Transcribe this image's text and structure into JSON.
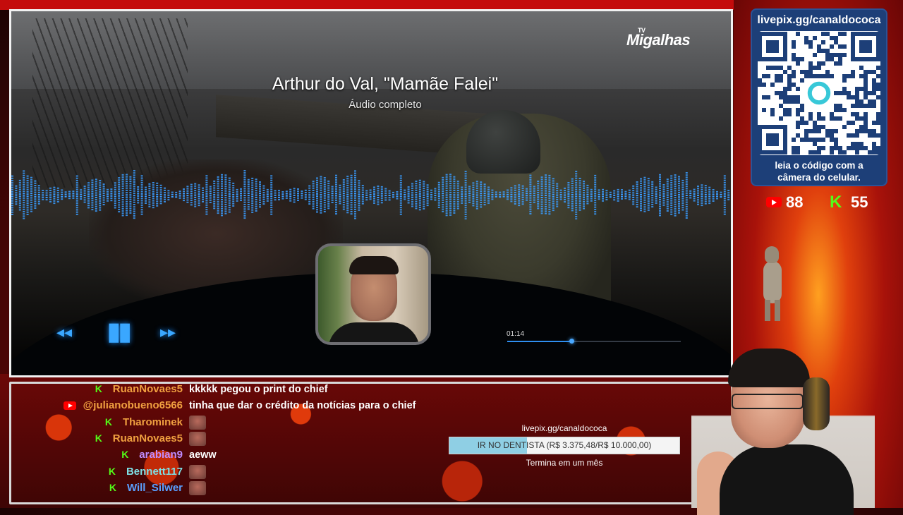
{
  "player": {
    "channel_logo": "Migalhas",
    "channel_logo_small": "TV",
    "title": "Arthur do Val, \"Mamãe Falei\"",
    "subtitle": "Áudio completo",
    "time": "01:14",
    "progress_fraction": 0.37,
    "accent": "#2f8ff0"
  },
  "chat": [
    {
      "platform": "kick",
      "user": "RuanNovaes5",
      "user_color": "#f0a040",
      "message": "kkkkk pegou o print do chief",
      "emote": false
    },
    {
      "platform": "youtube",
      "user": "@julianobueno6566",
      "user_color": "#f0a040",
      "message": "tinha que dar o crédito da notícias para o chief",
      "emote": false
    },
    {
      "platform": "kick",
      "user": "Tharominek",
      "user_color": "#f0a040",
      "message": "",
      "emote": true
    },
    {
      "platform": "kick",
      "user": "RuanNovaes5",
      "user_color": "#f0a040",
      "message": "",
      "emote": true
    },
    {
      "platform": "kick",
      "user": "arabian9",
      "user_color": "#c08cff",
      "message": "aeww",
      "emote": false
    },
    {
      "platform": "kick",
      "user": "Bennett117",
      "user_color": "#7ee0e6",
      "message": "",
      "emote": true
    },
    {
      "platform": "kick",
      "user": "Will_Silwer",
      "user_color": "#5aa0ff",
      "message": "",
      "emote": true
    }
  ],
  "goal": {
    "url": "livepix.gg/canaldococa",
    "label": "IR NO DENTISTA (R$ 3.375,48/R$ 10.000,00)",
    "fraction": 0.3375,
    "footer": "Termina em um mês"
  },
  "qr": {
    "title": "livepix.gg/canaldococa",
    "caption_line1": "leia o código com a",
    "caption_line2": "câmera do celular."
  },
  "viewers": {
    "youtube": "88",
    "kick": "55"
  }
}
